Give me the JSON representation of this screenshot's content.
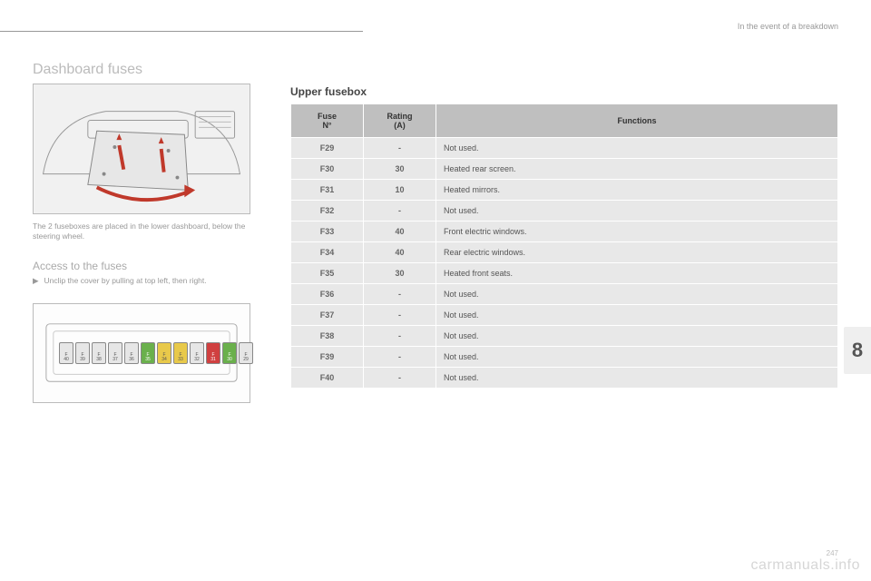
{
  "header": {
    "section": "In the event of a breakdown"
  },
  "title": "Dashboard fuses",
  "left": {
    "caption": "The 2 fuseboxes are placed in the lower dashboard, below the steering wheel.",
    "access_title": "Access to the fuses",
    "access_bullet_mark": "▶",
    "access_bullet": "Unclip the cover by pulling at top left, then right."
  },
  "right": {
    "title": "Upper fusebox",
    "th_fuse_line1": "Fuse",
    "th_fuse_line2": "N°",
    "th_rating_line1": "Rating",
    "th_rating_line2": "(A)",
    "th_func": "Functions",
    "rows": [
      {
        "n": "F29",
        "a": "-",
        "f": "Not used."
      },
      {
        "n": "F30",
        "a": "30",
        "f": "Heated rear screen."
      },
      {
        "n": "F31",
        "a": "10",
        "f": "Heated mirrors."
      },
      {
        "n": "F32",
        "a": "-",
        "f": "Not used."
      },
      {
        "n": "F33",
        "a": "40",
        "f": "Front electric windows."
      },
      {
        "n": "F34",
        "a": "40",
        "f": "Rear electric windows."
      },
      {
        "n": "F35",
        "a": "30",
        "f": "Heated front seats."
      },
      {
        "n": "F36",
        "a": "-",
        "f": "Not used."
      },
      {
        "n": "F37",
        "a": "-",
        "f": "Not used."
      },
      {
        "n": "F38",
        "a": "-",
        "f": "Not used."
      },
      {
        "n": "F39",
        "a": "-",
        "f": "Not used."
      },
      {
        "n": "F40",
        "a": "-",
        "f": "Not used."
      }
    ]
  },
  "fuse_diagram": {
    "items": [
      {
        "cls": "gray",
        "top": "F",
        "bot": "40"
      },
      {
        "cls": "gray",
        "top": "F",
        "bot": "39"
      },
      {
        "cls": "gray",
        "top": "F",
        "bot": "38"
      },
      {
        "cls": "gray",
        "top": "F",
        "bot": "37"
      },
      {
        "cls": "gray",
        "top": "F",
        "bot": "36"
      },
      {
        "cls": "green",
        "top": "F",
        "bot": "35"
      },
      {
        "cls": "yellow",
        "top": "F",
        "bot": "34"
      },
      {
        "cls": "yellow",
        "top": "F",
        "bot": "33"
      },
      {
        "cls": "gray",
        "top": "F",
        "bot": "32"
      },
      {
        "cls": "red",
        "top": "F",
        "bot": "31"
      },
      {
        "cls": "green",
        "top": "F",
        "bot": "30"
      },
      {
        "cls": "gray",
        "top": "F",
        "bot": "29"
      }
    ]
  },
  "chapter": "8",
  "page_number": "247",
  "watermark": "carmanuals.info"
}
